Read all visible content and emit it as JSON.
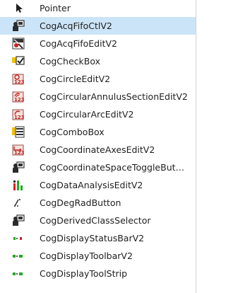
{
  "toolbox": {
    "items": [
      {
        "label": "Pointer",
        "icon": "pointer-arrow-icon"
      },
      {
        "label": "CogAcqFifoCtlV2",
        "icon": "component-icon",
        "selected": true
      },
      {
        "label": "CogAcqFifoEditV2",
        "icon": "acq-fifo-edit-icon"
      },
      {
        "label": "CogCheckBox",
        "icon": "checkbox-icon"
      },
      {
        "label": "CogCircleEditV2",
        "icon": "circle-edit-icon"
      },
      {
        "label": "CogCircularAnnulusSectionEditV2",
        "icon": "annulus-edit-icon"
      },
      {
        "label": "CogCircularArcEditV2",
        "icon": "arc-edit-icon"
      },
      {
        "label": "CogComboBox",
        "icon": "combobox-icon"
      },
      {
        "label": "CogCoordinateAxesEditV2",
        "icon": "axes-edit-icon"
      },
      {
        "label": "CogCoordinateSpaceToggleBut…",
        "icon": "component-icon"
      },
      {
        "label": "CogDataAnalysisEditV2",
        "icon": "data-analysis-icon"
      },
      {
        "label": "CogDegRadButton",
        "icon": "deg-rad-icon"
      },
      {
        "label": "CogDerivedClassSelector",
        "icon": "component-icon"
      },
      {
        "label": "CogDisplayStatusBarV2",
        "icon": "status-bar-icon"
      },
      {
        "label": "CogDisplayToolbarV2",
        "icon": "toolbar-icon"
      },
      {
        "label": "CogDisplayToolStrip",
        "icon": "toolstrip-icon"
      }
    ]
  },
  "colors": {
    "selected_bg": "#cce4f7",
    "text": "#1e1e1e"
  }
}
